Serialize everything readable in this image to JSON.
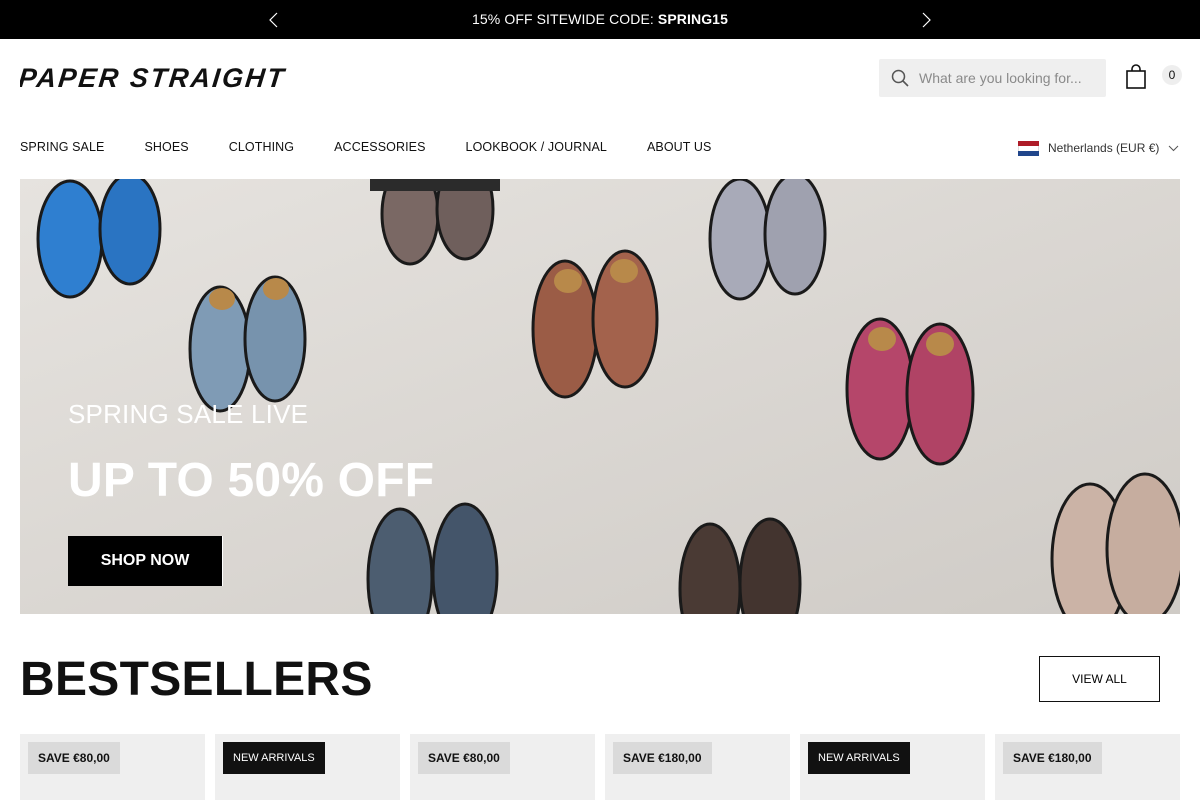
{
  "announcement": {
    "text": "15% OFF SITEWIDE CODE: ",
    "code": "SPRING15",
    "prev_icon": "chevron-left-icon",
    "next_icon": "chevron-right-icon"
  },
  "header": {
    "logo": "PAPER STRAIGHT",
    "search_placeholder": "What are you looking for...",
    "search_icon": "search-icon",
    "cart_icon": "shopping-bag-icon",
    "cart_count": "0"
  },
  "nav": {
    "items": [
      "SPRING SALE",
      "SHOES",
      "CLOTHING",
      "ACCESSORIES",
      "LOOKBOOK / JOURNAL",
      "ABOUT US"
    ]
  },
  "locale": {
    "label": "Netherlands (EUR €)",
    "flag_colors": [
      "#ae1c28",
      "#ffffff",
      "#21468b"
    ]
  },
  "hero": {
    "kicker": "SPRING SALE LIVE",
    "headline": "UP TO 50% OFF",
    "cta": "SHOP NOW"
  },
  "bestsellers": {
    "title": "BESTSELLERS",
    "view_all": "VIEW ALL",
    "cards": [
      {
        "badge": "SAVE €80,00",
        "type": "save"
      },
      {
        "badge": "NEW ARRIVALS",
        "type": "new"
      },
      {
        "badge": "SAVE €80,00",
        "type": "save"
      },
      {
        "badge": "SAVE €180,00",
        "type": "save"
      },
      {
        "badge": "NEW ARRIVALS",
        "type": "new"
      },
      {
        "badge": "SAVE €180,00",
        "type": "save"
      }
    ]
  }
}
